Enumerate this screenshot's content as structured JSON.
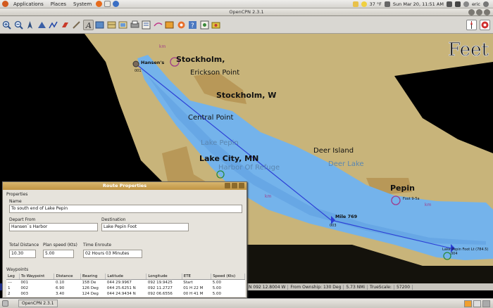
{
  "top_panel": {
    "menus": [
      "Applications",
      "Places",
      "System"
    ],
    "weather": "37 °F",
    "datetime": "Sun Mar 20, 11:51 AM",
    "user": "eric"
  },
  "window": {
    "title": "OpenCPN 2.3.1"
  },
  "toolbar": {
    "icons": [
      "zoom-in-icon",
      "zoom-out-icon",
      "north-up-icon",
      "route-icon",
      "track-icon",
      "tide-icon",
      "mob-icon",
      "measure-icon",
      "text-icon",
      "chart-list-icon",
      "grid-icon",
      "layers-icon",
      "print-icon",
      "route-manager-icon",
      "waypoint-icon",
      "ais-icon",
      "settings-icon",
      "help-icon",
      "about-icon"
    ]
  },
  "chart": {
    "feet_label": "Feet",
    "places": [
      {
        "name": "Stockholm,",
        "bold": true
      },
      {
        "name": "Erickson Point",
        "bold": false
      },
      {
        "name": "Stockholm, W",
        "bold": true
      },
      {
        "name": "Central Point",
        "bold": false
      },
      {
        "name": "Lake Pepin",
        "bold": false,
        "water": true
      },
      {
        "name": "Lake City, MN",
        "bold": true
      },
      {
        "name": "Harbor Of Refuge",
        "bold": false,
        "water": true
      },
      {
        "name": "Deer Island",
        "bold": false
      },
      {
        "name": "Deer Lake",
        "bold": false,
        "water": true
      },
      {
        "name": "Pepin",
        "bold": true
      }
    ],
    "waypoints": [
      {
        "name": "Hansen's",
        "id": "001"
      },
      {
        "name": "Mile 769",
        "id": "003"
      },
      {
        "name": "Lake Pepin Foot Lt (784.5)",
        "id": "004"
      },
      {
        "name": "Foot 9-5a",
        "id": ""
      }
    ],
    "km_marker": "km"
  },
  "status_bar": {
    "position": "N 092 12.8004 W",
    "ownship": "From Ownship: 130 Deg",
    "distance": "5.73 NMi",
    "scale": "TrueScale:",
    "scale_value": "57200"
  },
  "dialog": {
    "title": "Route Properties",
    "section_properties": "Properties",
    "name_label": "Name",
    "name_value": "To south end of Lake Pepin",
    "depart_label": "Depart From",
    "depart_value": "Hansen`s Harbor",
    "dest_label": "Destination",
    "dest_value": "Lake Pepin Foot",
    "total_dist_label": "Total Distance",
    "total_dist_value": "10.30",
    "plan_speed_label": "Plan speed (Kts)",
    "plan_speed_value": "5.00",
    "time_enroute_label": "Time Enroute",
    "time_enroute_value": "02 Hours  03 Minutes",
    "waypoints_label": "Waypoints",
    "columns": [
      "Leg",
      "To Waypoint",
      "Distance",
      "Bearing",
      "Latitude",
      "Longitude",
      "ETE",
      "Speed (Kts)"
    ],
    "rows": [
      [
        "---",
        "001",
        "0.10",
        "158 De",
        "044 29.9967",
        "092 19.9425",
        "Start",
        "5.00"
      ],
      [
        "1",
        "002",
        "6.90",
        "126 Deg",
        "044 25.6251 N",
        "092 11.2727",
        "01 H   22 M",
        "5.00"
      ],
      [
        "2",
        "003",
        "3.40",
        "124 Deg",
        "044 24.9434 N",
        "092 06.6556",
        "00 H   41 M",
        "5.00"
      ]
    ]
  },
  "taskbar": {
    "task": "OpenCPN 2.3.1"
  },
  "colors": {
    "water": "#74b3eb",
    "deep_water": "#5a9be0",
    "land": "#c8b47a",
    "urban": "#b89858",
    "route": "#2c3fd6",
    "dialog_title": "#c19443"
  }
}
